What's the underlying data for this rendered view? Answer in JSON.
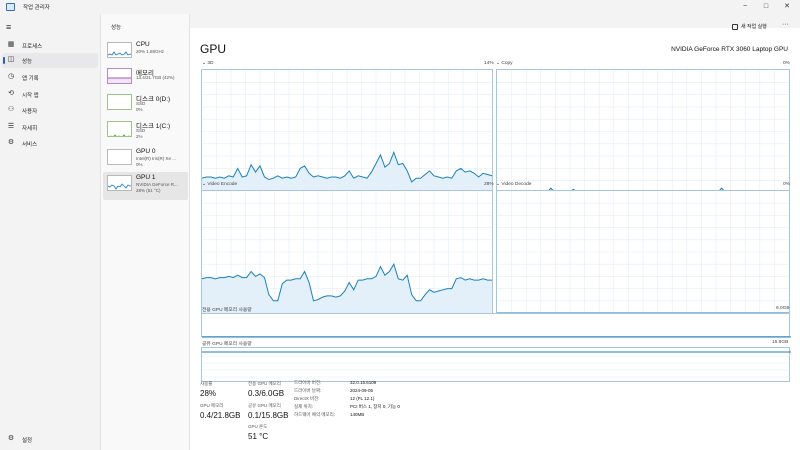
{
  "window": {
    "title": "작업 관리자",
    "controls": {
      "minimize": "−",
      "maximize": "□",
      "close": "✕"
    }
  },
  "nav": {
    "menu_icon": "hamburger-icon",
    "items": [
      {
        "label": "프로세스",
        "icon": "processes-icon",
        "active": false
      },
      {
        "label": "성능",
        "icon": "performance-icon",
        "active": true
      },
      {
        "label": "앱 기록",
        "icon": "app-history-icon",
        "active": false
      },
      {
        "label": "시작 앱",
        "icon": "startup-icon",
        "active": false
      },
      {
        "label": "사용자",
        "icon": "users-icon",
        "active": false
      },
      {
        "label": "자세히",
        "icon": "details-icon",
        "active": false
      },
      {
        "label": "서비스",
        "icon": "services-icon",
        "active": false
      }
    ],
    "settings_label": "설정"
  },
  "devices": {
    "header": "성능",
    "items": [
      {
        "name": "CPU",
        "sub1": "20% 1.88GHz",
        "sub2": "",
        "color": "#1b7fbf"
      },
      {
        "name": "메모리",
        "sub1": "13.4/31.7GB (42%)",
        "sub2": "",
        "color": "#8a2aa6"
      },
      {
        "name": "디스크 0(D:)",
        "sub1": "SSD",
        "sub2": "0%",
        "color": "#4c9a2a"
      },
      {
        "name": "디스크 1(C:)",
        "sub1": "SSD",
        "sub2": "2%",
        "color": "#4c9a2a"
      },
      {
        "name": "GPU 0",
        "sub1": "Intel(R) Iris(R) Xe ...",
        "sub2": "0%",
        "color": "#1b7fbf"
      },
      {
        "name": "GPU 1",
        "sub1": "NVIDIA GeForce R...",
        "sub2": "28% (51 °C)",
        "color": "#1b7fbf"
      }
    ]
  },
  "toolbar": {
    "run_task": "새 작업 실행",
    "more": "···"
  },
  "main": {
    "title": "GPU",
    "model": "NVIDIA GeForce RTX 3060 Laptop GPU",
    "engines": [
      {
        "name": "3D",
        "pct": "14%"
      },
      {
        "name": "Copy",
        "pct": "0%"
      },
      {
        "name": "Video Encode",
        "pct": "28%"
      },
      {
        "name": "Video Decode",
        "pct": "0%"
      }
    ],
    "dedicated_mem_label": "전용 GPU 메모리 사용량",
    "dedicated_mem_max": "6.0GB",
    "shared_mem_label": "공유 GPU 메모리 사용량",
    "shared_mem_max": "15.8GB"
  },
  "stats": {
    "utilization": {
      "label": "사용률",
      "value": "28%"
    },
    "dedicated": {
      "label": "전용 GPU 메모리",
      "value": "0.3/6.0GB"
    },
    "gpu_memory": {
      "label": "GPU 메모리",
      "value": "0.4/21.8GB"
    },
    "shared": {
      "label": "공유 GPU 메모리",
      "value": "0.1/15.8GB"
    },
    "temp": {
      "label": "GPU 온도",
      "value": "51 °C"
    }
  },
  "specs": [
    {
      "label": "드라이버 버전:",
      "value": "32.0.15.6109"
    },
    {
      "label": "드라이버 날짜:",
      "value": "2024-09-05"
    },
    {
      "label": "DirectX 버전:",
      "value": "12 (FL 12.1)"
    },
    {
      "label": "실제 위치:",
      "value": "PCI 버스 1, 장치 0, 기능 0"
    },
    {
      "label": "하드웨어 예약 메모리:",
      "value": "140MB"
    }
  ],
  "chart_data": [
    {
      "type": "area",
      "name": "3D",
      "ylim": [
        0,
        100
      ],
      "values": [
        12,
        13,
        13,
        12,
        13,
        12,
        14,
        13,
        20,
        13,
        14,
        23,
        17,
        22,
        13,
        11,
        12,
        14,
        12,
        13,
        12,
        13,
        20,
        22,
        16,
        13,
        14,
        13,
        12,
        13,
        13,
        12,
        14,
        18,
        12,
        14,
        13,
        12,
        17,
        24,
        31,
        21,
        24,
        33,
        23,
        24,
        18,
        9,
        12,
        12,
        15,
        18,
        14,
        13,
        12,
        13,
        12,
        18,
        20,
        17,
        18,
        16,
        13,
        16,
        15,
        14
      ]
    },
    {
      "type": "area",
      "name": "Copy",
      "ylim": [
        0,
        100
      ],
      "values": [
        0,
        0,
        0,
        0,
        0,
        0,
        0,
        0,
        0,
        0,
        0,
        0,
        4,
        0,
        1,
        0,
        0,
        3,
        0,
        0,
        0,
        0,
        0,
        0,
        0,
        0,
        0,
        0,
        2,
        0,
        0,
        0,
        0,
        0,
        0,
        0,
        0,
        0,
        0,
        0,
        0,
        0,
        0,
        0,
        0,
        0,
        0,
        0,
        0,
        0,
        4,
        0,
        0,
        0,
        0,
        0,
        0,
        0,
        0,
        0,
        0,
        0,
        0,
        0,
        2,
        0
      ]
    },
    {
      "type": "area",
      "name": "Video Encode",
      "ylim": [
        0,
        100
      ],
      "values": [
        28,
        29,
        29,
        28,
        29,
        29,
        30,
        29,
        31,
        29,
        29,
        34,
        30,
        32,
        29,
        15,
        10,
        10,
        24,
        27,
        27,
        28,
        28,
        34,
        25,
        10,
        11,
        13,
        14,
        14,
        13,
        14,
        18,
        25,
        19,
        27,
        27,
        28,
        28,
        30,
        38,
        31,
        34,
        40,
        28,
        27,
        31,
        15,
        10,
        10,
        15,
        19,
        17,
        18,
        19,
        20,
        20,
        28,
        29,
        27,
        28,
        27,
        27,
        28,
        27,
        27
      ]
    },
    {
      "type": "area",
      "name": "Video Decode",
      "ylim": [
        0,
        100
      ],
      "values": [
        0,
        0,
        0,
        0,
        0,
        0,
        0,
        0,
        0,
        0,
        0,
        0,
        0,
        0,
        0,
        0,
        0,
        0,
        0,
        0,
        0,
        0,
        0,
        0,
        0,
        0,
        0,
        0,
        0,
        0,
        0,
        0,
        0,
        0,
        0,
        0,
        0,
        0,
        0,
        0,
        0,
        0,
        0,
        0,
        0,
        0,
        0,
        0,
        0,
        0,
        0,
        0,
        0,
        0,
        0,
        0,
        0,
        0,
        0,
        0,
        0,
        0,
        0,
        0,
        0,
        0
      ]
    }
  ]
}
